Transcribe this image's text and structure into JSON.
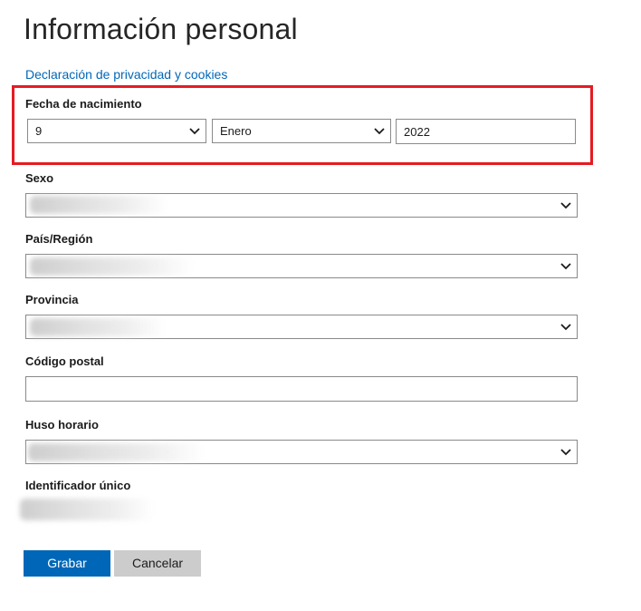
{
  "page": {
    "title": "Información personal",
    "privacy_link": "Declaración de privacidad y cookies"
  },
  "birth_date": {
    "label": "Fecha de nacimiento",
    "day": "9",
    "month": "Enero",
    "year": "2022"
  },
  "sex": {
    "label": "Sexo",
    "value": ""
  },
  "country": {
    "label": "País/Región",
    "value": ""
  },
  "province": {
    "label": "Provincia",
    "value": ""
  },
  "postal_code": {
    "label": "Código postal",
    "value": ""
  },
  "timezone": {
    "label": "Huso horario",
    "value": ""
  },
  "unique_id": {
    "label": "Identificador único",
    "value": ""
  },
  "actions": {
    "save_label": "Grabar",
    "cancel_label": "Cancelar"
  },
  "colors": {
    "accent": "#0067b8",
    "highlight": "#e51b23",
    "secondary_button": "#cccccc"
  },
  "icons": {
    "dropdown": "chevron-down-icon"
  }
}
